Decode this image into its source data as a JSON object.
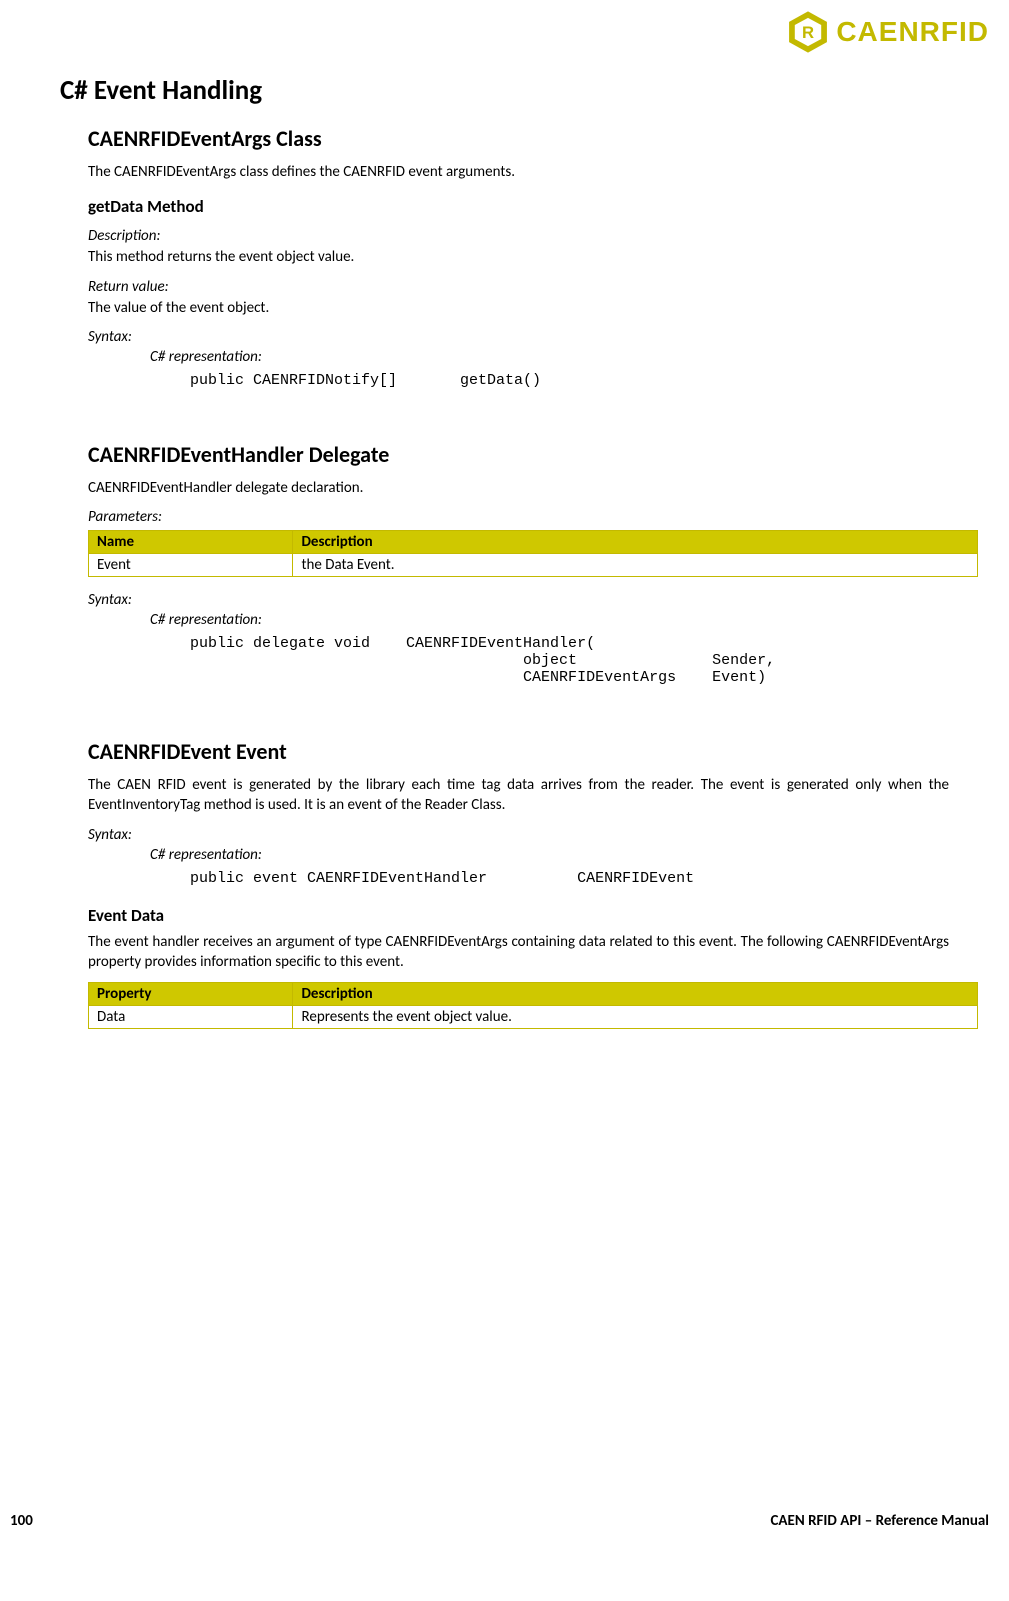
{
  "logo": {
    "text": "CAENRFID"
  },
  "h1": "C# Event Handling",
  "s1": {
    "h2": "CAENRFIDEventArgs Class",
    "intro": "The CAENRFIDEventArgs class defines the CAENRFID event arguments.",
    "method_h3": "getData Method",
    "desc_label": "Description:",
    "desc_text": "This method returns the event object value.",
    "ret_label": "Return value:",
    "ret_text": "The value of the event object.",
    "syn_label": "Syntax:",
    "csrep_label": "C# representation:",
    "code": "public CAENRFIDNotify[]       getData()"
  },
  "s2": {
    "h2": "CAENRFIDEventHandler Delegate",
    "intro": "CAENRFIDEventHandler delegate declaration.",
    "param_label": "Parameters:",
    "th1": "Name",
    "th2": "Description",
    "row1c1": "Event",
    "row1c2": "the Data Event.",
    "syn_label": "Syntax:",
    "csrep_label": "C# representation:",
    "code": "public delegate void    CAENRFIDEventHandler(\n                                     object               Sender,\n                                     CAENRFIDEventArgs    Event)"
  },
  "s3": {
    "h2": "CAENRFIDEvent Event",
    "intro": "The CAEN RFID event is generated by the library each time tag data arrives from the reader. The event is generated only when the EventInventoryTag method is used. It is an event of the Reader Class.",
    "syn_label": "Syntax:",
    "csrep_label": "C# representation:",
    "code": "public event CAENRFIDEventHandler          CAENRFIDEvent",
    "evdata_h3": "Event Data",
    "evdata_text": "The event handler receives an argument of type CAENRFIDEventArgs containing data related to this event. The following CAENRFIDEventArgs property provides information specific to this event.",
    "th1": "Property",
    "th2": "Description",
    "row1c1": "Data",
    "row1c2": "Represents the event object value."
  },
  "footer": {
    "page": "100",
    "title": "CAEN RFID API – Reference Manual"
  }
}
